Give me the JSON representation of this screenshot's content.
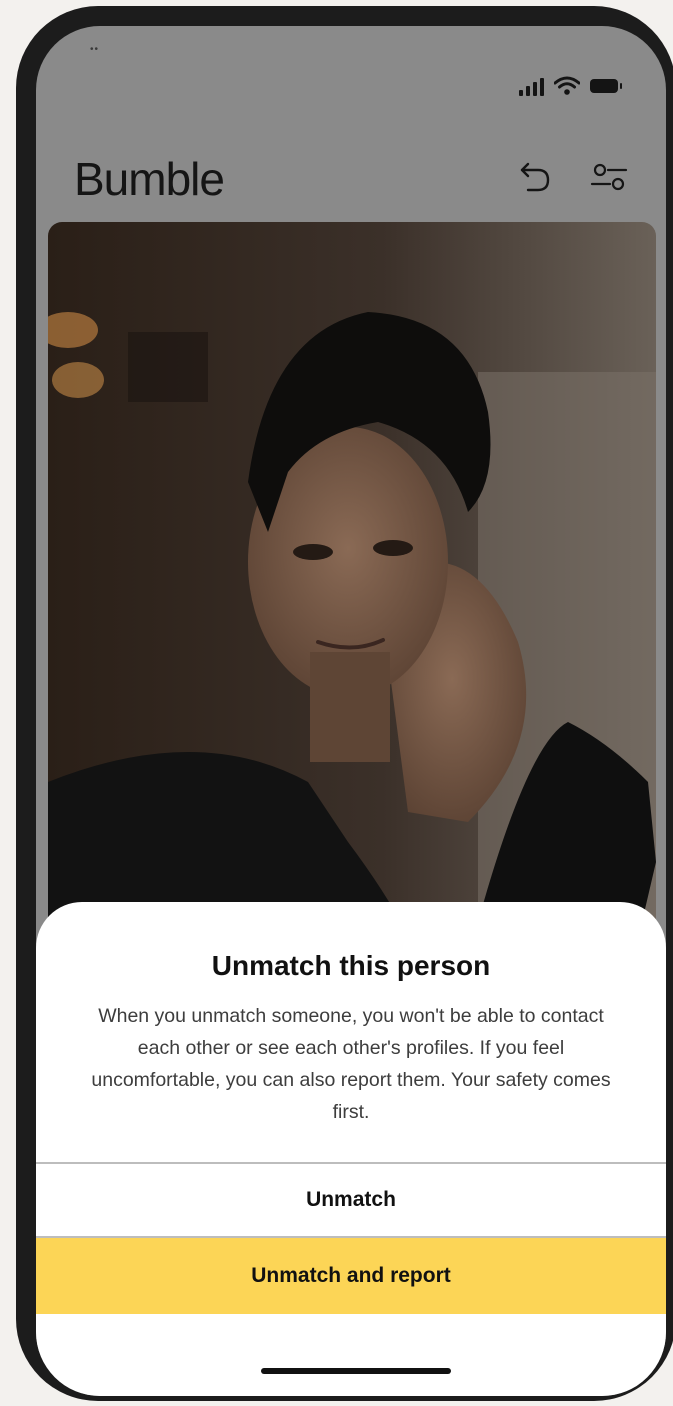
{
  "app": {
    "title": "Bumble"
  },
  "status_bar": {
    "icons": [
      "signal-icon",
      "wifi-icon",
      "battery-icon"
    ],
    "camera_dots": "••"
  },
  "header": {
    "icons": [
      "undo-icon",
      "filter-icon"
    ]
  },
  "profile_photo": {
    "alt": "profile-photo"
  },
  "dialog": {
    "title": "Unmatch this person",
    "body": "When you unmatch someone, you won't be able to contact each other or see each other's profiles. If you feel uncomfortable, you can also report them. Your safety comes first.",
    "primary_label": "Unmatch",
    "secondary_label": "Unmatch and report"
  },
  "colors": {
    "accent": "#fcd556",
    "overlay": "#8a8a8a",
    "sheet": "#ffffff"
  }
}
